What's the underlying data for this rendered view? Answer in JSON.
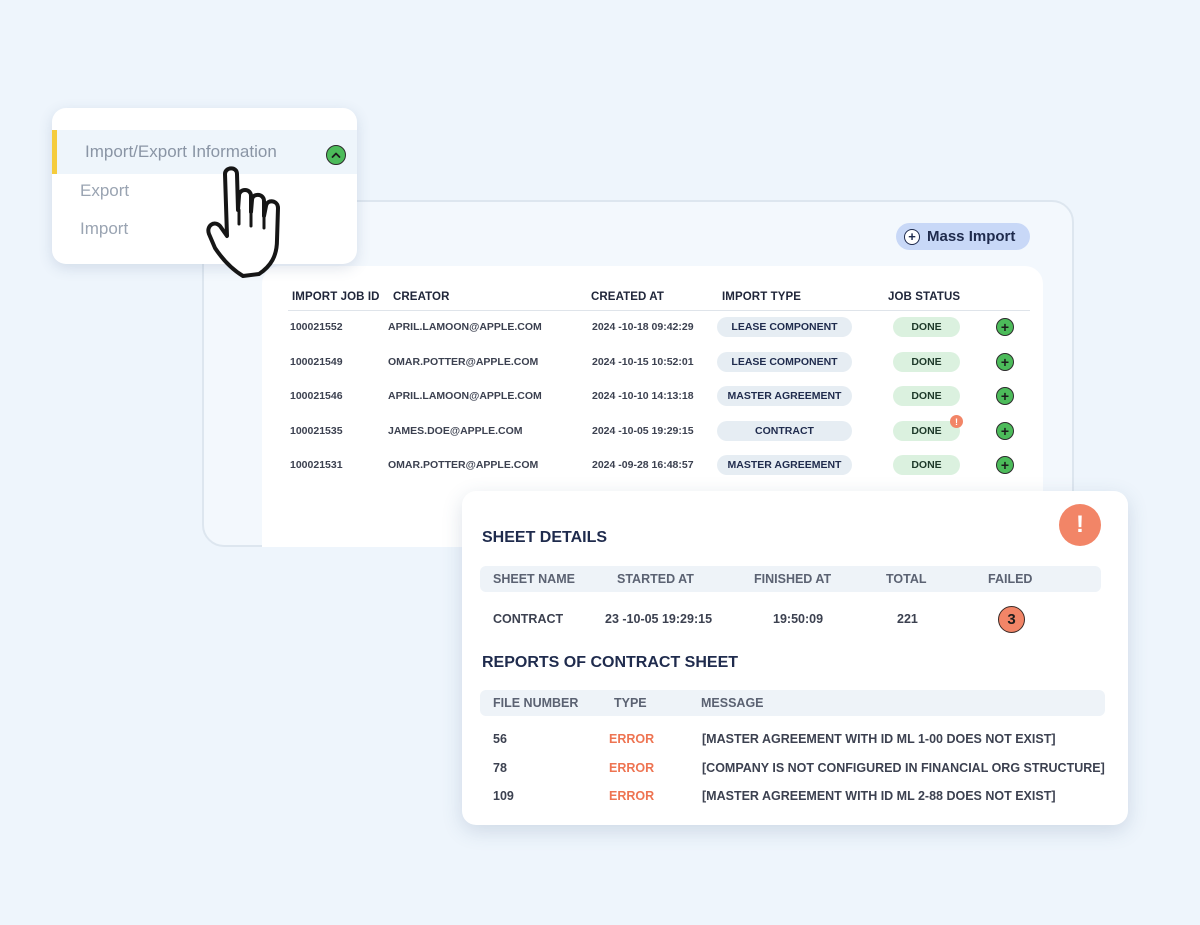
{
  "menu": {
    "active_label": "Import/Export Information",
    "items": [
      {
        "label": "Export"
      },
      {
        "label": "Import"
      }
    ]
  },
  "toolbar": {
    "mass_import_label": "Mass Import",
    "mass_import_icon": "plus-icon"
  },
  "jobs": {
    "columns": [
      "IMPORT JOB ID",
      "CREATOR",
      "CREATED AT",
      "IMPORT TYPE",
      "JOB STATUS"
    ],
    "rows": [
      {
        "id": "100021552",
        "creator": "APRIL.LAMOON@APPLE.COM",
        "created_at": "2024 -10-18 09:42:29",
        "type": "LEASE COMPONENT",
        "status": "DONE",
        "warning": false
      },
      {
        "id": "100021549",
        "creator": "OMAR.POTTER@APPLE.COM",
        "created_at": "2024 -10-15 10:52:01",
        "type": "LEASE COMPONENT",
        "status": "DONE",
        "warning": false
      },
      {
        "id": "100021546",
        "creator": "APRIL.LAMOON@APPLE.COM",
        "created_at": "2024 -10-10 14:13:18",
        "type": "MASTER AGREEMENT",
        "status": "DONE",
        "warning": false
      },
      {
        "id": "100021535",
        "creator": "JAMES.DOE@APPLE.COM",
        "created_at": "2024 -10-05 19:29:15",
        "type": "CONTRACT",
        "status": "DONE",
        "warning": true
      },
      {
        "id": "100021531",
        "creator": "OMAR.POTTER@APPLE.COM",
        "created_at": "2024 -09-28 16:48:57",
        "type": "MASTER AGREEMENT",
        "status": "DONE",
        "warning": false
      }
    ],
    "warning_glyph": "!",
    "add_glyph": "+"
  },
  "sheet_details": {
    "title": "SHEET DETAILS",
    "alert_glyph": "!",
    "columns": [
      "SHEET NAME",
      "STARTED AT",
      "FINISHED AT",
      "TOTAL",
      "FAILED"
    ],
    "row": {
      "sheet_name": "CONTRACT",
      "started_at": "23 -10-05 19:29:15",
      "finished_at": "19:50:09",
      "total": "221",
      "failed": "3"
    }
  },
  "reports": {
    "title": "REPORTS OF CONTRACT SHEET",
    "columns": [
      "FILE NUMBER",
      "TYPE",
      "MESSAGE"
    ],
    "rows": [
      {
        "file_number": "56",
        "type": "ERROR",
        "message": "[MASTER AGREEMENT WITH ID ML 1-00 DOES NOT EXIST]"
      },
      {
        "file_number": "78",
        "type": "ERROR",
        "message": "[COMPANY IS NOT CONFIGURED IN FINANCIAL ORG STRUCTURE]"
      },
      {
        "file_number": "109",
        "type": "ERROR",
        "message": "[MASTER AGREEMENT WITH ID ML 2-88 DOES NOT EXIST]"
      }
    ]
  },
  "colors": {
    "accent_yellow": "#f5cc3d",
    "success_green": "#4cbb5a",
    "error_orange": "#ee7452",
    "navy": "#1f2b4d",
    "page_bg": "#eef5fc"
  }
}
